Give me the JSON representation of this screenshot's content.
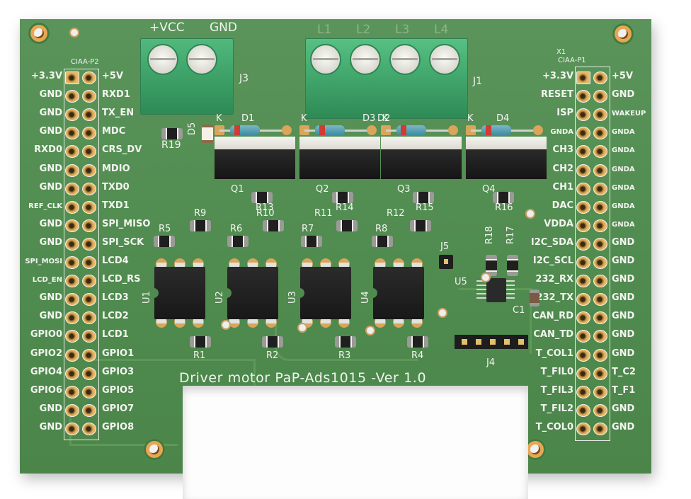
{
  "board": {
    "title": "Driver motor PaP-Ads1015 -Ver 1.0",
    "colors": {
      "soldermask": "#4f8a4e",
      "silkscreen": "#f2f4ef",
      "copper_pad": "#d9a55a",
      "terminal_block": "#3fa46a"
    }
  },
  "connector_p2": {
    "ref": "CIAA-P2",
    "left_labels": [
      "+3.3V",
      "GND",
      "GND",
      "GND",
      "RXD0",
      "GND",
      "GND",
      "REF_CLK",
      "GND",
      "GND",
      "SPI_MOSI",
      "LCD_EN",
      "GND",
      "GND",
      "GPIO0",
      "GPIO2",
      "GPIO4",
      "GPIO6",
      "GND",
      "GND"
    ],
    "right_labels": [
      "+5V",
      "RXD1",
      "TX_EN",
      "MDC",
      "CRS_DV",
      "MDIO",
      "TXD0",
      "TXD1",
      "SPI_MISO",
      "SPI_SCK",
      "LCD4",
      "LCD_RS",
      "LCD3",
      "LCD2",
      "LCD1",
      "GPIO1",
      "GPIO3",
      "GPIO5",
      "GPIO7",
      "GPIO8"
    ]
  },
  "connector_p1": {
    "ref": "X1",
    "name": "CIAA-P1",
    "left_labels": [
      "+3.3V",
      "RESET",
      "ISP",
      "GNDA",
      "CH3",
      "CH2",
      "CH1",
      "DAC",
      "VDDA",
      "I2C_SDA",
      "I2C_SCL",
      "232_RX",
      "232_TX",
      "CAN_RD",
      "CAN_TD",
      "T_COL1",
      "T_FIL0",
      "T_FIL3",
      "T_FIL2",
      "T_COL0"
    ],
    "right_labels": [
      "+5V",
      "GND",
      "WAKEUP",
      "GNDA",
      "GNDA",
      "GNDA",
      "GNDA",
      "GNDA",
      "GNDA",
      "GND",
      "GND",
      "GND",
      "GND",
      "GND",
      "GND",
      "GND",
      "T_C2",
      "T_F1",
      "GND",
      "GND"
    ]
  },
  "terminals": {
    "j3": {
      "ref": "J3",
      "pins": [
        "+VCC",
        "GND"
      ]
    },
    "j1": {
      "ref": "J1",
      "pins": [
        "L1",
        "L2",
        "L3",
        "L4"
      ]
    }
  },
  "diodes": [
    {
      "ref": "D1",
      "cathode": "K"
    },
    {
      "ref": "D2",
      "cathode": "K"
    },
    {
      "ref": "D3",
      "cathode": "K"
    },
    {
      "ref": "D4",
      "cathode": "K"
    }
  ],
  "led": {
    "ref": "D5"
  },
  "mosfets": [
    "Q1",
    "Q2",
    "Q3",
    "Q4"
  ],
  "optocouplers": [
    "U1",
    "U2",
    "U3",
    "U4"
  ],
  "adc": {
    "ref": "U5"
  },
  "capacitor": {
    "ref": "C1"
  },
  "jumper": {
    "ref": "J5"
  },
  "pin_header": {
    "ref": "J4"
  },
  "resistors": {
    "r1": "R1",
    "r2": "R2",
    "r3": "R3",
    "r4": "R4",
    "r5": "R5",
    "r6": "R6",
    "r7": "R7",
    "r8": "R8",
    "r9": "R9",
    "r10": "R10",
    "r11": "R11",
    "r12": "R12",
    "r13": "R13",
    "r14": "R14",
    "r15": "R15",
    "r16": "R16",
    "r17": "R17",
    "r18": "R18",
    "r19": "R19"
  }
}
